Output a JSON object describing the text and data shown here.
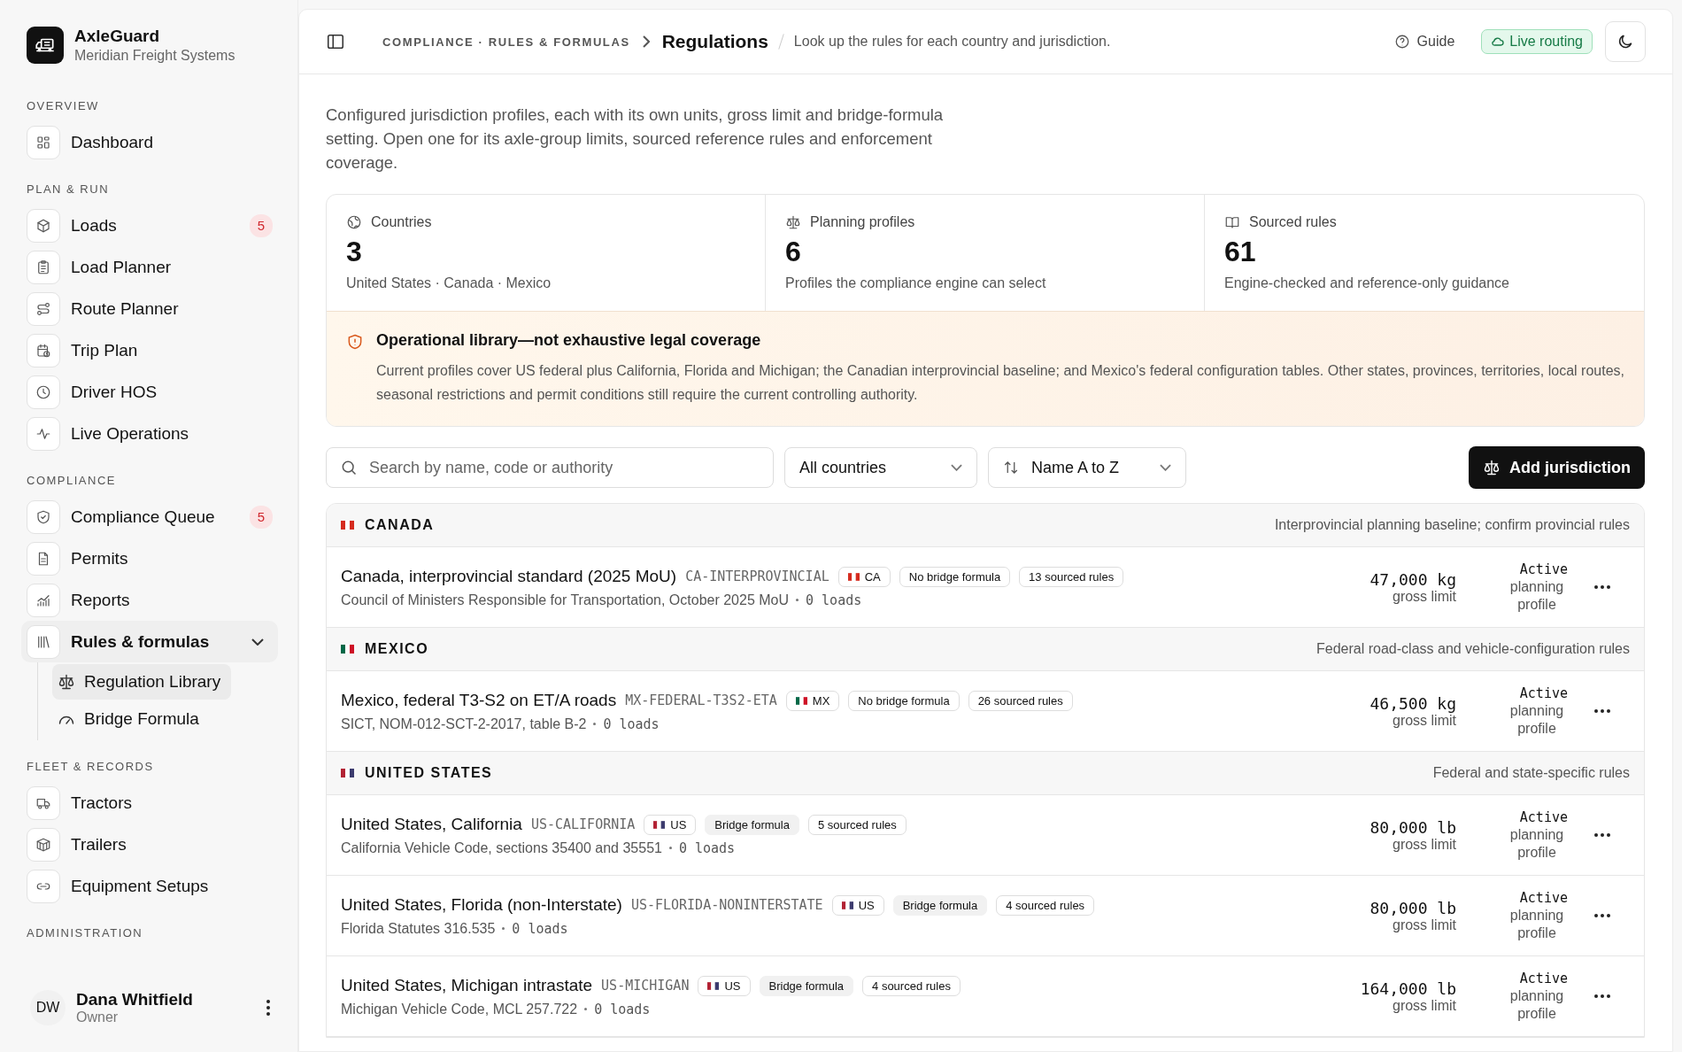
{
  "brand": {
    "name": "AxleGuard",
    "org": "Meridian Freight Systems"
  },
  "sidebar": {
    "sections": [
      {
        "title": "OVERVIEW",
        "items": [
          {
            "label": "Dashboard",
            "selected": false
          }
        ]
      },
      {
        "title": "PLAN & RUN",
        "items": [
          {
            "label": "Loads",
            "badge": "5",
            "selected": false
          },
          {
            "label": "Load Planner",
            "selected": false
          },
          {
            "label": "Route Planner",
            "selected": false
          },
          {
            "label": "Trip Plan",
            "selected": false
          },
          {
            "label": "Driver HOS",
            "selected": false
          },
          {
            "label": "Live Operations",
            "selected": false
          }
        ]
      },
      {
        "title": "COMPLIANCE",
        "items": [
          {
            "label": "Compliance Queue",
            "badge": "5",
            "selected": false
          },
          {
            "label": "Permits",
            "selected": false
          },
          {
            "label": "Reports",
            "selected": false
          },
          {
            "label": "Rules & formulas",
            "selected": true,
            "expanded": true,
            "children": [
              {
                "label": "Regulation Library",
                "selected": true
              },
              {
                "label": "Bridge Formula",
                "selected": false
              }
            ]
          }
        ]
      },
      {
        "title": "FLEET & RECORDS",
        "items": [
          {
            "label": "Tractors",
            "selected": false
          },
          {
            "label": "Trailers",
            "selected": false
          },
          {
            "label": "Equipment Setups",
            "selected": false
          }
        ]
      },
      {
        "title": "ADMINISTRATION"
      }
    ]
  },
  "user": {
    "initials": "DW",
    "name": "Dana Whitfield",
    "role": "Owner"
  },
  "header": {
    "breadcrumb": "COMPLIANCE · RULES & FORMULAS",
    "title": "Regulations",
    "subtitle": "Look up the rules for each country and jurisdiction.",
    "guide": "Guide",
    "status": "Live routing"
  },
  "intro": "Configured jurisdiction profiles, each with its own units, gross limit and bridge-formula setting. Open one for its axle-group limits, sourced reference rules and enforcement coverage.",
  "stats": [
    {
      "label": "Countries",
      "value": "3",
      "note": "United States · Canada · Mexico"
    },
    {
      "label": "Planning profiles",
      "value": "6",
      "note": "Profiles the compliance engine can select"
    },
    {
      "label": "Sourced rules",
      "value": "61",
      "note": "Engine-checked and reference-only guidance"
    }
  ],
  "notice": {
    "title": "Operational library—not exhaustive legal coverage",
    "body": "Current profiles cover US federal plus California, Florida and Michigan; the Canadian interprovincial baseline; and Mexico's federal configuration tables. Other states, provinces, territories, local routes, seasonal restrictions and permit conditions still require the current controlling authority."
  },
  "toolbar": {
    "search": {
      "placeholder": "Search by name, code or authority"
    },
    "country": "All countries",
    "sort": "Name A to Z",
    "add": "Add jurisdiction"
  },
  "groups": [
    {
      "name": "CANADA",
      "kind": "canada",
      "note": "Interprovincial planning baseline; confirm provincial rules",
      "rows": [
        {
          "title": "Canada, interprovincial standard (2025 MoU)",
          "code": "CA-INTERPROVINCIAL",
          "country": "CA",
          "bridge": false,
          "bridge_label": "No bridge formula",
          "rules": "13 sourced rules",
          "source": "Council of Ministers Responsible for Transportation, October 2025 MoU",
          "loads": "0 loads",
          "limit": "47,000 kg",
          "limit_label": "gross limit",
          "status": "Active",
          "status_note": "planning profile"
        }
      ]
    },
    {
      "name": "MEXICO",
      "kind": "mexico",
      "note": "Federal road-class and vehicle-configuration rules",
      "rows": [
        {
          "title": "Mexico, federal T3-S2 on ET/A roads",
          "code": "MX-FEDERAL-T3S2-ETA",
          "country": "MX",
          "bridge": false,
          "bridge_label": "No bridge formula",
          "rules": "26 sourced rules",
          "source": "SICT, NOM-012-SCT-2-2017, table B-2",
          "loads": "0 loads",
          "limit": "46,500 kg",
          "limit_label": "gross limit",
          "status": "Active",
          "status_note": "planning profile"
        }
      ]
    },
    {
      "name": "UNITED STATES",
      "kind": "usa",
      "note": "Federal and state-specific rules",
      "rows": [
        {
          "title": "United States, California",
          "code": "US-CALIFORNIA",
          "country": "US",
          "bridge": true,
          "bridge_label": "Bridge formula",
          "rules": "5 sourced rules",
          "source": "California Vehicle Code, sections 35400 and 35551",
          "loads": "0 loads",
          "limit": "80,000 lb",
          "limit_label": "gross limit",
          "status": "Active",
          "status_note": "planning profile"
        },
        {
          "title": "United States, Florida (non-Interstate)",
          "code": "US-FLORIDA-NONINTERSTATE",
          "country": "US",
          "bridge": true,
          "bridge_label": "Bridge formula",
          "rules": "4 sourced rules",
          "source": "Florida Statutes 316.535",
          "loads": "0 loads",
          "limit": "80,000 lb",
          "limit_label": "gross limit",
          "status": "Active",
          "status_note": "planning profile"
        },
        {
          "title": "United States, Michigan intrastate",
          "code": "US-MICHIGAN",
          "country": "US",
          "bridge": true,
          "bridge_label": "Bridge formula",
          "rules": "4 sourced rules",
          "source": "Michigan Vehicle Code, MCL 257.722",
          "loads": "0 loads",
          "limit": "164,000 lb",
          "limit_label": "gross limit",
          "status": "Active",
          "status_note": "planning profile"
        }
      ]
    }
  ]
}
